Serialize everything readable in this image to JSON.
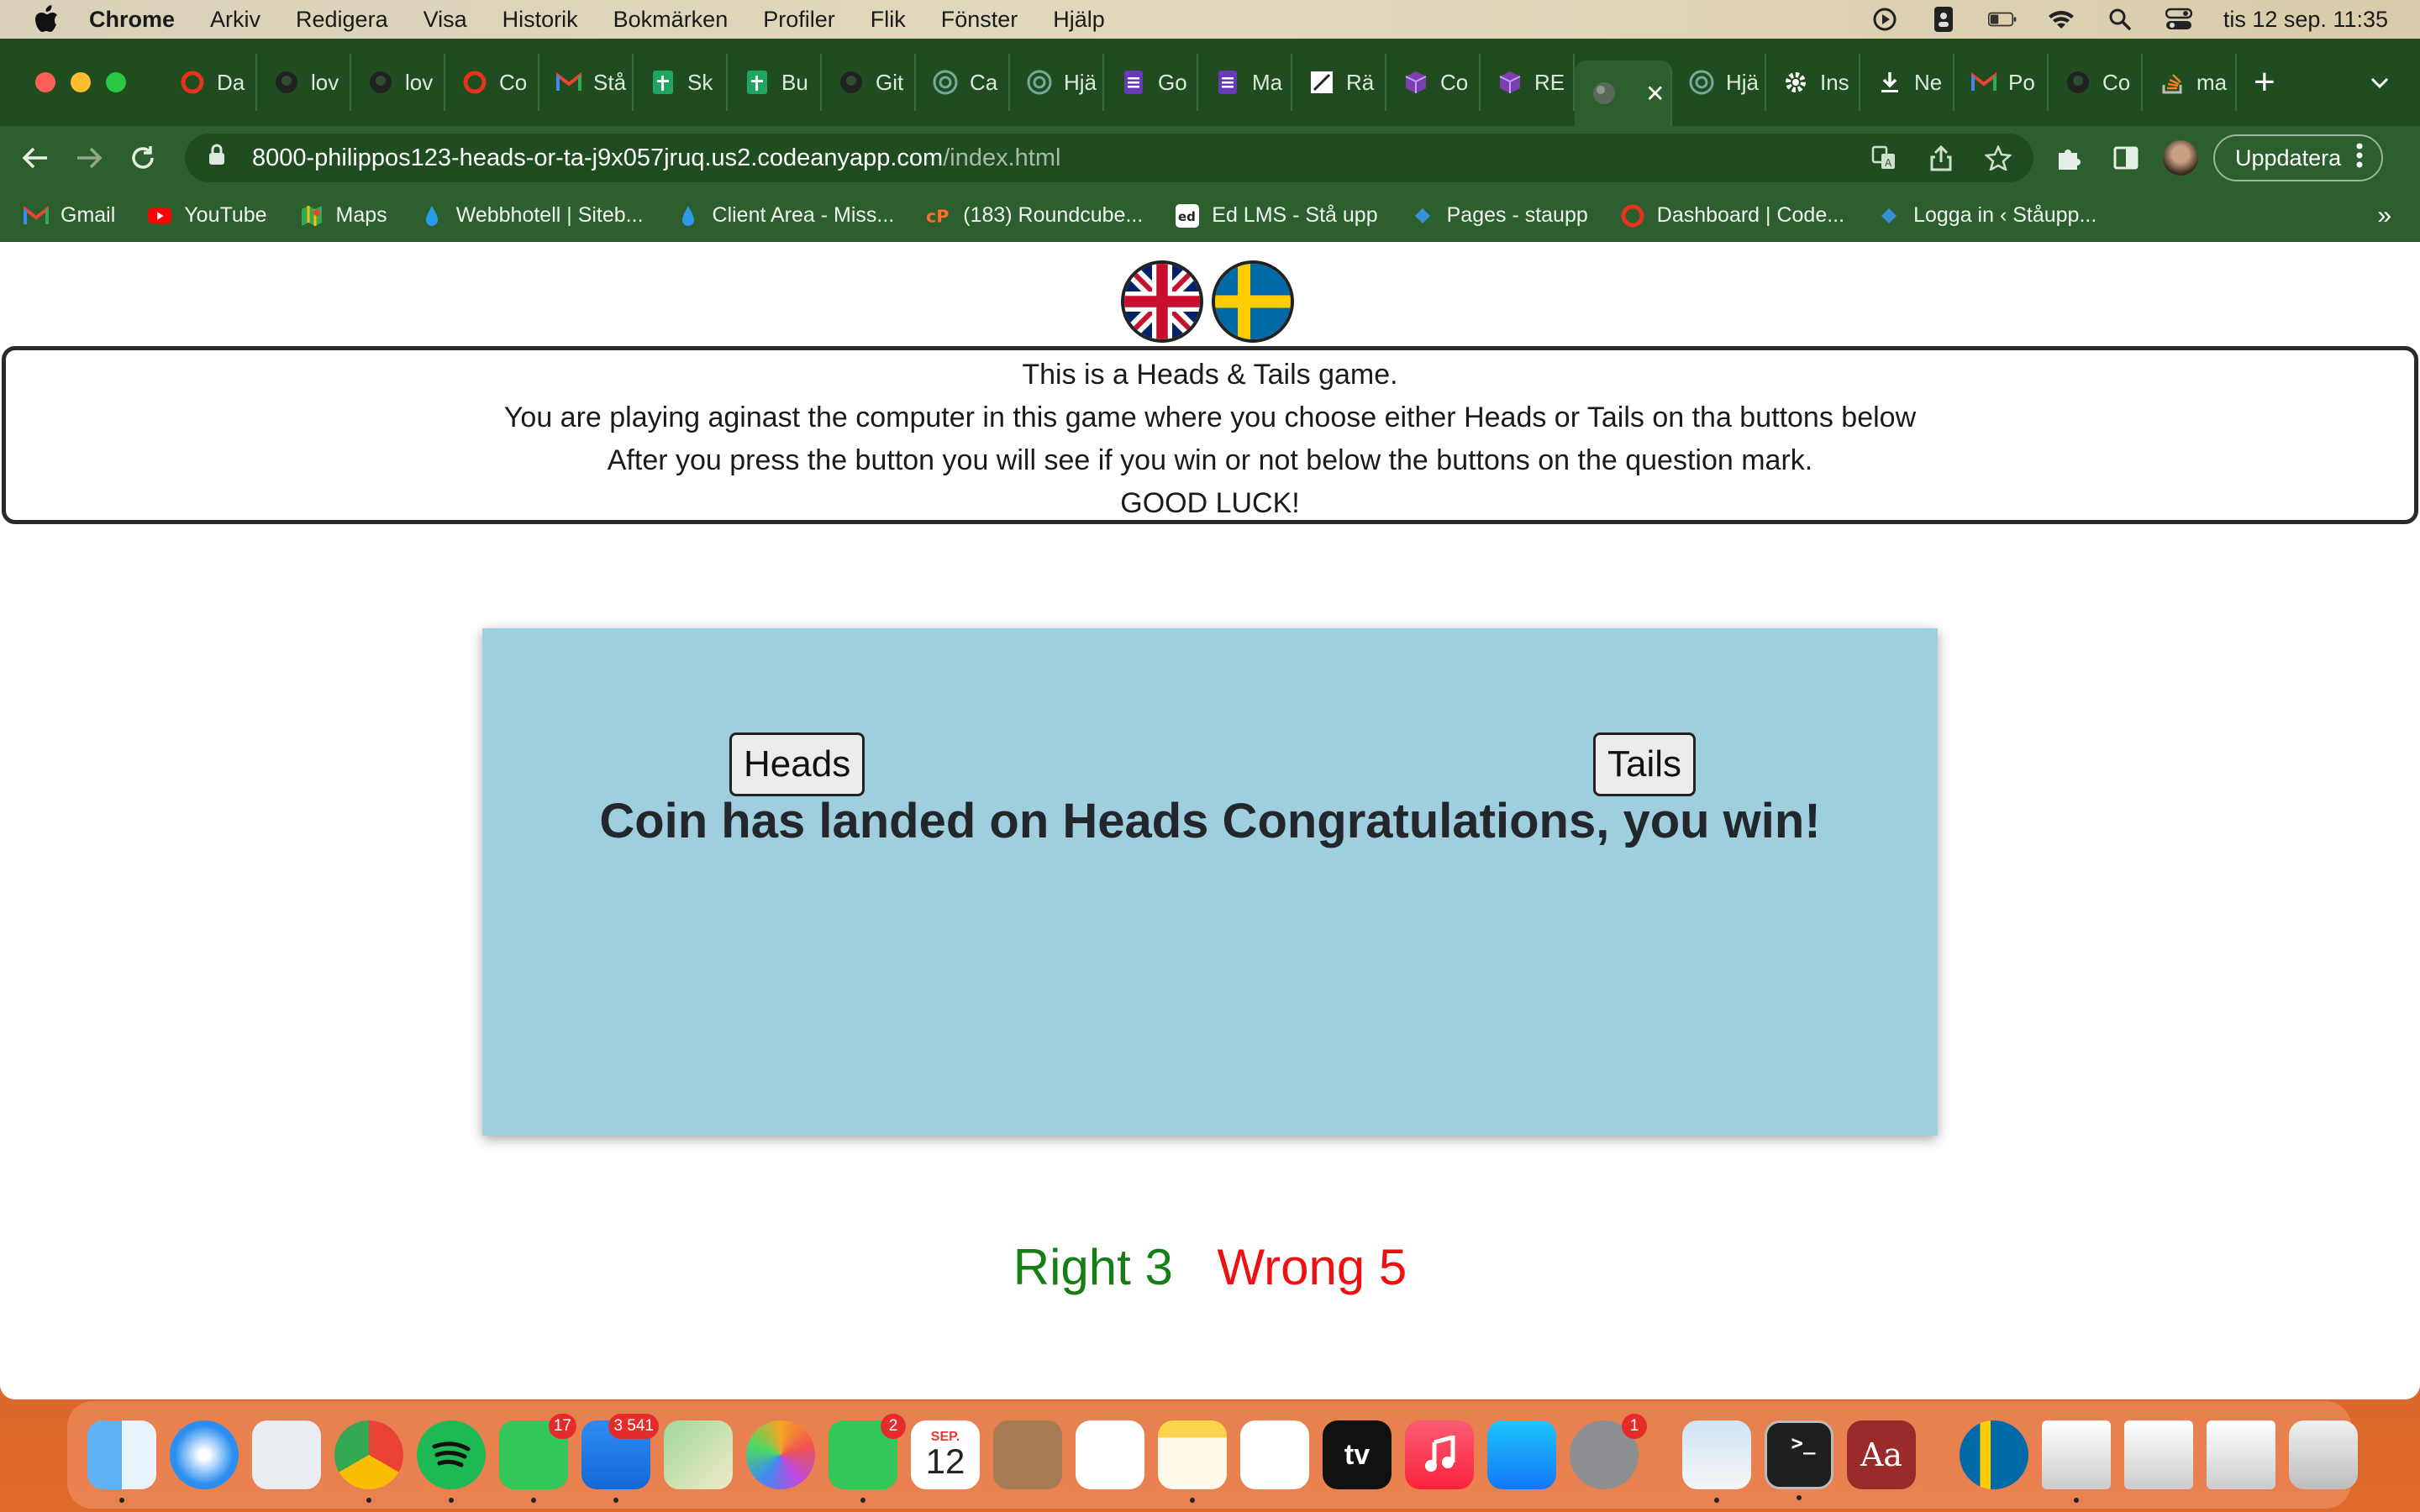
{
  "menubar": {
    "app": "Chrome",
    "items": [
      "Arkiv",
      "Redigera",
      "Visa",
      "Historik",
      "Bokmärken",
      "Profiler",
      "Flik",
      "Fönster",
      "Hjälp"
    ],
    "clock": "tis 12 sep. 11:35"
  },
  "tabs": [
    {
      "label": "Da",
      "icon": "opera-icon",
      "color": "#e8321e"
    },
    {
      "label": "lov",
      "icon": "github-icon",
      "color": "#222222"
    },
    {
      "label": "lov",
      "icon": "github-icon",
      "color": "#222222"
    },
    {
      "label": "Co",
      "icon": "opera-icon",
      "color": "#e8321e"
    },
    {
      "label": "Stå",
      "icon": "gmail-icon",
      "color": "#ffffff"
    },
    {
      "label": "Sk",
      "icon": "sheets-icon",
      "color": "#21a464"
    },
    {
      "label": "Bu",
      "icon": "sheets-icon",
      "color": "#21a464"
    },
    {
      "label": "Git",
      "icon": "github-icon",
      "color": "#222222"
    },
    {
      "label": "Ca",
      "icon": "openai-icon",
      "color": "#74aa9c"
    },
    {
      "label": "Hjä",
      "icon": "openai-icon",
      "color": "#74aa9c"
    },
    {
      "label": "Go",
      "icon": "forms-icon",
      "color": "#673ab7"
    },
    {
      "label": "Ma",
      "icon": "forms-icon",
      "color": "#673ab7"
    },
    {
      "label": "Rä",
      "icon": "pen-icon",
      "color": "#ffffff"
    },
    {
      "label": "Co",
      "icon": "cube-icon",
      "color": "#7b3fb0"
    },
    {
      "label": "RE",
      "icon": "cube-icon",
      "color": "#7b3fb0"
    },
    {
      "label": "",
      "icon": "globe-icon",
      "color": "#5a6a5a"
    },
    {
      "label": "Hjä",
      "icon": "openai-icon",
      "color": "#74aa9c"
    },
    {
      "label": "Ins",
      "icon": "gear-icon",
      "color": "#ffffff"
    },
    {
      "label": "Ne",
      "icon": "download-icon",
      "color": "#ffffff"
    },
    {
      "label": "Po",
      "icon": "gmail-icon",
      "color": "#ffffff"
    },
    {
      "label": "Co",
      "icon": "github-icon",
      "color": "#222222"
    },
    {
      "label": "ma",
      "icon": "stack-icon",
      "color": "#f48024"
    }
  ],
  "active_tab_index": 15,
  "close_tab_glyph": "✕",
  "url": {
    "host": "8000-philippos123-heads-or-ta-j9x057jruq.us2.codeanyapp.com",
    "path": "/index.html"
  },
  "update_button": "Uppdatera",
  "bookmarks": [
    {
      "label": "Gmail",
      "icon": "gmail-icon"
    },
    {
      "label": "YouTube",
      "icon": "youtube-icon"
    },
    {
      "label": "Maps",
      "icon": "maps-icon"
    },
    {
      "label": "Webbhotell | Siteb...",
      "icon": "drop-icon"
    },
    {
      "label": "Client Area - Miss...",
      "icon": "drop-icon"
    },
    {
      "label": "(183) Roundcube...",
      "icon": "cpanel-icon"
    },
    {
      "label": "Ed LMS - Stå upp",
      "icon": "ed-icon"
    },
    {
      "label": "Pages - staupp",
      "icon": "diamond-icon"
    },
    {
      "label": "Dashboard | Code...",
      "icon": "opera-icon"
    },
    {
      "label": "Logga in ‹ Ståupp...",
      "icon": "diamond-icon"
    }
  ],
  "bookmarks_more": "»",
  "game": {
    "intro_lines": [
      "This is a Heads & Tails game.",
      "You are playing aginast the computer in this game where you choose either Heads or Tails on tha buttons below",
      "After you press the button you will see if you win or not below the buttons on the question mark.",
      "GOOD LUCK!"
    ],
    "heads_label": "Heads",
    "tails_label": "Tails",
    "result": "Coin has landed on Heads Congratulations, you win!",
    "right_label": "Right 3",
    "wrong_label": "Wrong 5"
  },
  "dock": {
    "apps": [
      {
        "name": "finder-icon",
        "badge": ""
      },
      {
        "name": "safari-icon",
        "badge": ""
      },
      {
        "name": "launchpad-icon",
        "badge": ""
      },
      {
        "name": "chrome-icon",
        "badge": ""
      },
      {
        "name": "spotify-icon",
        "badge": ""
      },
      {
        "name": "messages-icon",
        "badge": "17"
      },
      {
        "name": "mail-icon",
        "badge": "3 541"
      },
      {
        "name": "maps-icon",
        "badge": ""
      },
      {
        "name": "photos-icon",
        "badge": ""
      },
      {
        "name": "facetime-icon",
        "badge": "2"
      },
      {
        "name": "calendar-icon",
        "badge": ""
      },
      {
        "name": "contacts-icon",
        "badge": ""
      },
      {
        "name": "reminders-icon",
        "badge": ""
      },
      {
        "name": "notes-icon",
        "badge": ""
      },
      {
        "name": "freeform-icon",
        "badge": ""
      },
      {
        "name": "appletv-icon",
        "badge": ""
      },
      {
        "name": "music-icon",
        "badge": ""
      },
      {
        "name": "appstore-icon",
        "badge": ""
      },
      {
        "name": "settings-icon",
        "badge": "1"
      },
      {
        "name": "preview-icon",
        "badge": ""
      },
      {
        "name": "terminal-icon",
        "badge": ""
      },
      {
        "name": "dictionary-icon",
        "badge": ""
      },
      {
        "name": "sweden-flag-icon",
        "badge": ""
      },
      {
        "name": "screenshot-icon",
        "badge": ""
      },
      {
        "name": "screenshot-icon",
        "badge": ""
      },
      {
        "name": "screenshot-icon",
        "badge": ""
      },
      {
        "name": "trash-icon",
        "badge": ""
      }
    ],
    "calendar_month": "SEP.",
    "calendar_day": "12",
    "appletv_label": "tv",
    "dictionary_label": "Aa"
  }
}
